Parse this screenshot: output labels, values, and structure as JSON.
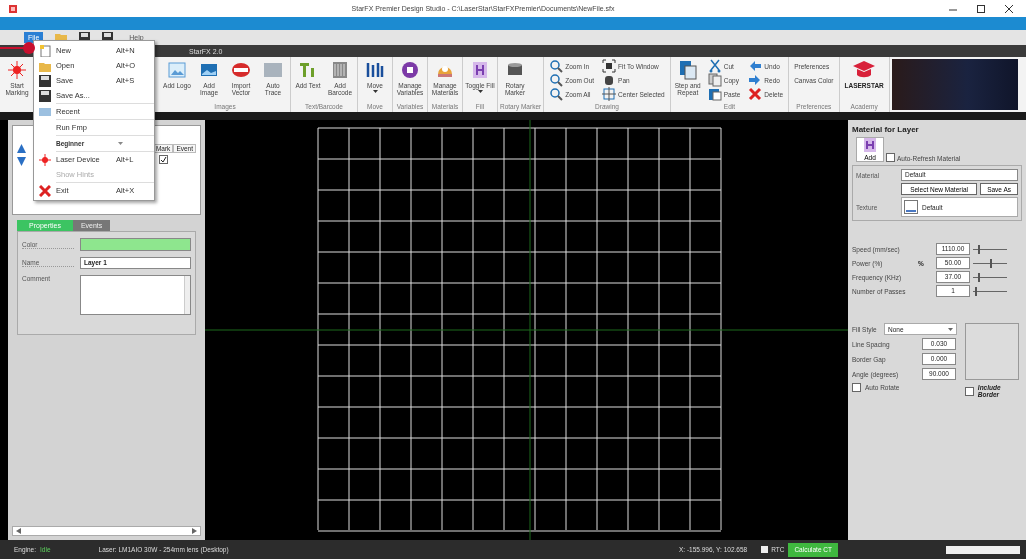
{
  "window": {
    "title": "StarFX Premier Design Studio - C:\\LaserStar\\StarFXPremier\\Documents\\NewFile.sfx"
  },
  "quick_access": {
    "file_button": "File",
    "help": "Help"
  },
  "ribbon_tabs": [
    {
      "label": "StarFX 2.0",
      "selected": false
    }
  ],
  "ribbon": [
    {
      "items": [
        {
          "label": "Start Marking",
          "kind": "large"
        }
      ]
    },
    {
      "label": "Images",
      "items": [
        {
          "label": "Add Logo",
          "kind": "large"
        },
        {
          "label": "Add Image",
          "kind": "large"
        },
        {
          "label": "Import Vector",
          "kind": "large"
        },
        {
          "label": "Auto Trace",
          "kind": "large"
        }
      ]
    },
    {
      "label": "Text/Barcode",
      "items": [
        {
          "label": "Add Text",
          "kind": "large"
        },
        {
          "label": "Add Barcode",
          "kind": "large"
        }
      ]
    },
    {
      "label": "Move",
      "items": [
        {
          "label": "Move",
          "kind": "large",
          "dropdown": true
        }
      ]
    },
    {
      "label": "Variables",
      "items": [
        {
          "label": "Manage Variables",
          "kind": "large"
        }
      ]
    },
    {
      "label": "Materials",
      "items": [
        {
          "label": "Manage Materials",
          "kind": "large"
        }
      ]
    },
    {
      "label": "Fill",
      "items": [
        {
          "label": "Toggle Fill",
          "kind": "large",
          "dropdown": true
        }
      ]
    },
    {
      "label": "Rotary Marker",
      "items": [
        {
          "label": "Rotary Marker",
          "kind": "large"
        }
      ]
    },
    {
      "label": "Drawing",
      "items": [
        {
          "label": "Zoom In",
          "kind": "small"
        },
        {
          "label": "Zoom Out",
          "kind": "small"
        },
        {
          "label": "Zoom All",
          "kind": "small"
        },
        {
          "label": "Fit To Window",
          "kind": "small"
        },
        {
          "label": "Pan",
          "kind": "small"
        },
        {
          "label": "Center Selected",
          "kind": "small"
        }
      ]
    },
    {
      "label": "Edit",
      "items": [
        {
          "label": "Step and Repeat",
          "kind": "large"
        },
        {
          "label": "Cut",
          "kind": "small"
        },
        {
          "label": "Copy",
          "kind": "small"
        },
        {
          "label": "Paste",
          "kind": "small"
        },
        {
          "label": "Undo",
          "kind": "small"
        },
        {
          "label": "Redo",
          "kind": "small"
        },
        {
          "label": "Delete",
          "kind": "small"
        }
      ]
    },
    {
      "label": "Preferences",
      "items": [
        {
          "label": "Preferences",
          "kind": "text"
        },
        {
          "label": "Canvas Color",
          "kind": "text"
        }
      ]
    },
    {
      "label": "Academy",
      "items": [
        {
          "label": "LASERSTAR",
          "kind": "logo"
        }
      ]
    }
  ],
  "file_menu": [
    {
      "kind": "item",
      "label": "New",
      "shortcut": "Alt+N",
      "disabled": false
    },
    {
      "kind": "item",
      "label": "Open",
      "shortcut": "Alt+O",
      "disabled": false
    },
    {
      "kind": "item",
      "label": "Save",
      "shortcut": "Alt+S",
      "disabled": false
    },
    {
      "kind": "item",
      "label": "Save As...",
      "disabled": false
    },
    {
      "kind": "separator"
    },
    {
      "kind": "item",
      "label": "Recent",
      "disabled": false
    },
    {
      "kind": "separator"
    },
    {
      "kind": "item",
      "label": "Run Fmp",
      "disabled": false
    },
    {
      "kind": "separator"
    },
    {
      "kind": "combo",
      "value": "Beginner"
    },
    {
      "kind": "separator"
    },
    {
      "kind": "item",
      "label": "Laser Device",
      "shortcut": "Alt+L",
      "disabled": false
    },
    {
      "kind": "item",
      "label": "Show Hints",
      "disabled": true
    },
    {
      "kind": "separator"
    },
    {
      "kind": "item",
      "label": "Exit",
      "shortcut": "Alt+X",
      "disabled": false
    }
  ],
  "layers": {
    "columns": [
      "Mark",
      "Event"
    ],
    "rows": [
      {
        "mark": true
      }
    ]
  },
  "layer_tabs": [
    {
      "label": "Properties",
      "selected": true
    },
    {
      "label": "Events",
      "selected": false
    }
  ],
  "layer_properties": {
    "color_label": "Color",
    "color": "#8ee68e",
    "name_label": "Name",
    "name": "Layer 1",
    "comment_label": "Comment"
  },
  "material_panel": {
    "title": "Material for Layer",
    "add": "Add",
    "auto_refresh": {
      "label": "Auto-Refresh Material",
      "checked": false
    },
    "material_label": "Material",
    "material": "Default",
    "select_button": "Select New Material",
    "save_button": "Save As",
    "texture_label": "Texture",
    "texture": "Default",
    "parameters": [
      {
        "label": "Speed (mm/sec)",
        "value": "1110.00",
        "level": 0.15
      },
      {
        "label": "Power (%)",
        "prefix": "%",
        "value": "50.00",
        "level": 0.5
      },
      {
        "label": "Frequency (KHz)",
        "value": "37.00",
        "level": 0.15
      },
      {
        "label": "Number of Passes",
        "value": "1",
        "level": 0.05
      }
    ],
    "fill_style_label": "Fill Style",
    "fill_style": "None",
    "fill_fields": [
      {
        "label": "Line Spacing",
        "value": "0.030"
      },
      {
        "label": "Border Gap",
        "value": "0.000"
      },
      {
        "label": "Angle (degrees)",
        "value": "90.000"
      }
    ],
    "auto_rotate": {
      "label": "Auto Rotate",
      "checked": false
    },
    "include_border": {
      "label": "Include Border",
      "checked": false
    }
  },
  "status_bar": {
    "engine_label": "Engine:",
    "engine_state": "Idle",
    "laser": "Laser: LM1AIO 30W - 254mm lens (Desktop)",
    "coords": "X: -155.996, Y: 102.658",
    "rtc": {
      "label": "RTC",
      "checked": false
    },
    "calc_button": "Calculate CT",
    "level": 0
  }
}
